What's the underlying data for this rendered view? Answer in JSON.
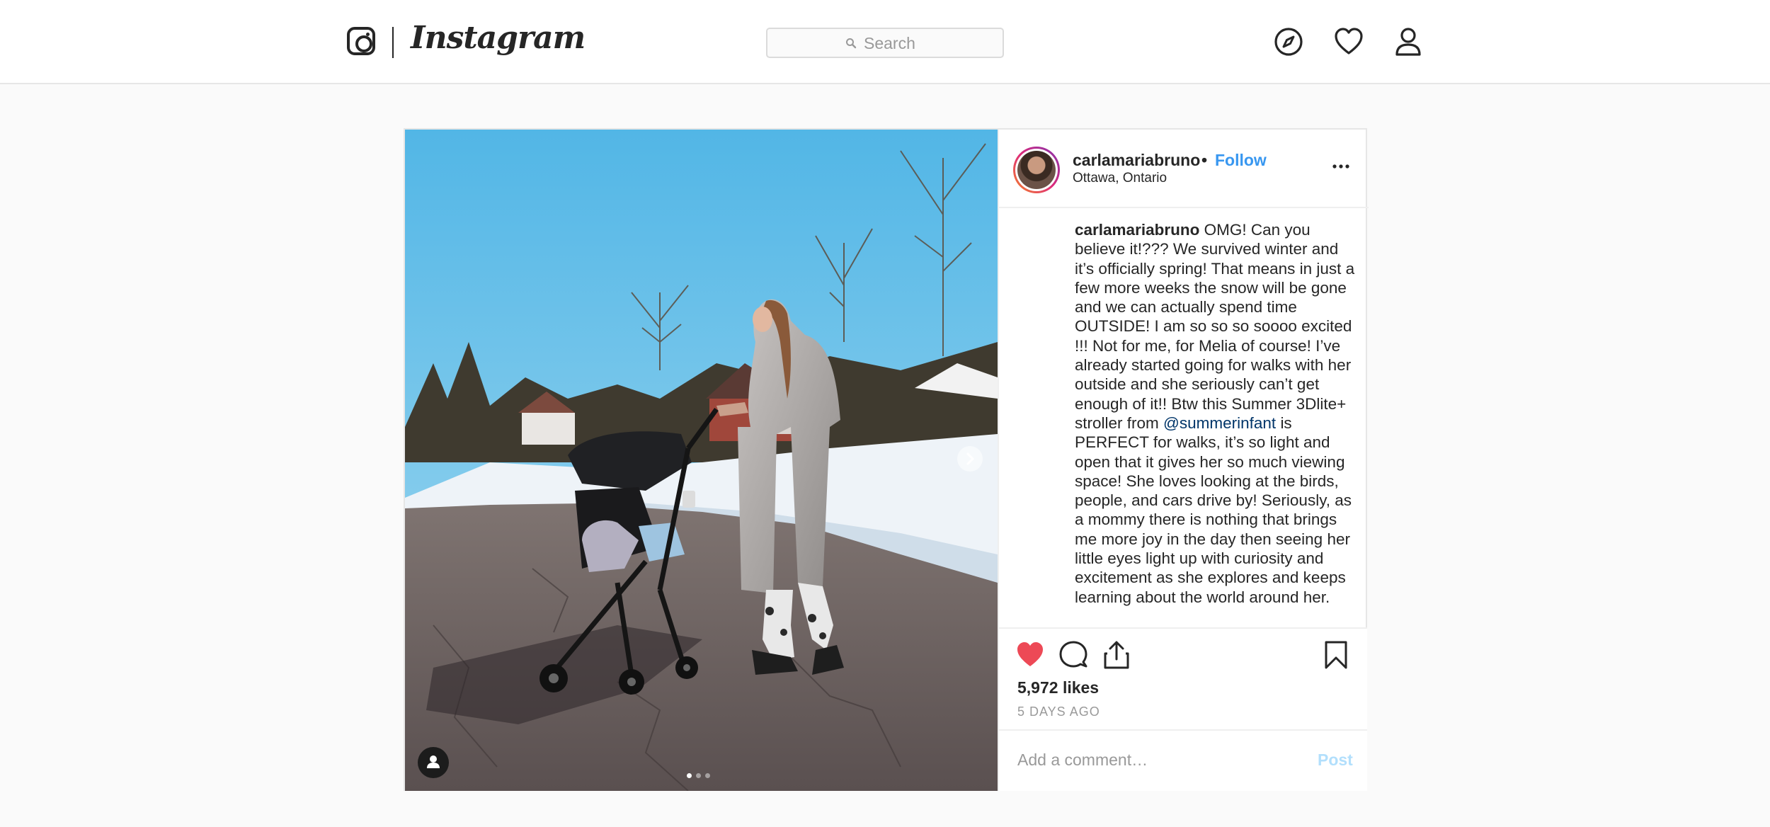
{
  "brand": {
    "wordmark": "Instagram"
  },
  "search": {
    "placeholder": "Search"
  },
  "nav": {
    "icons": [
      "compass-icon",
      "heart-icon",
      "profile-icon"
    ]
  },
  "post": {
    "username": "carlamariabruno",
    "separator": "•",
    "follow_label": "Follow",
    "location": "Ottawa, Ontario",
    "caption": {
      "username": "carlamariabruno",
      "text_before": "OMG! Can you believe it!??? We survived winter and it’s officially spring! That means in just a few more weeks the snow will be gone and we can actually spend time OUTSIDE! I am so so so soooo excited !!! Not for me, for Melia of course! I’ve already started going for walks with her outside and she seriously can’t get enough of it!! Btw this Summer 3Dlite+ stroller from",
      "mention": "@summerinfant",
      "text_after": "is PERFECT for walks, it’s so light and open that it gives her so much viewing space! She loves looking at the birds, people, and cars drive by! Seriously, as a mommy there is nothing that brings me more joy in the day then seeing her little eyes light up with curiosity and excitement as she explores and keeps learning about the world around her."
    },
    "likes": "5,972 likes",
    "timestamp": "5 DAYS AGO",
    "liked": true,
    "carousel": {
      "count": 3,
      "active_index": 0
    },
    "comment": {
      "placeholder": "Add a comment…",
      "post_label": "Post"
    }
  },
  "colors": {
    "link": "#3897f0",
    "like": "#ed4956",
    "mention": "#003569"
  }
}
